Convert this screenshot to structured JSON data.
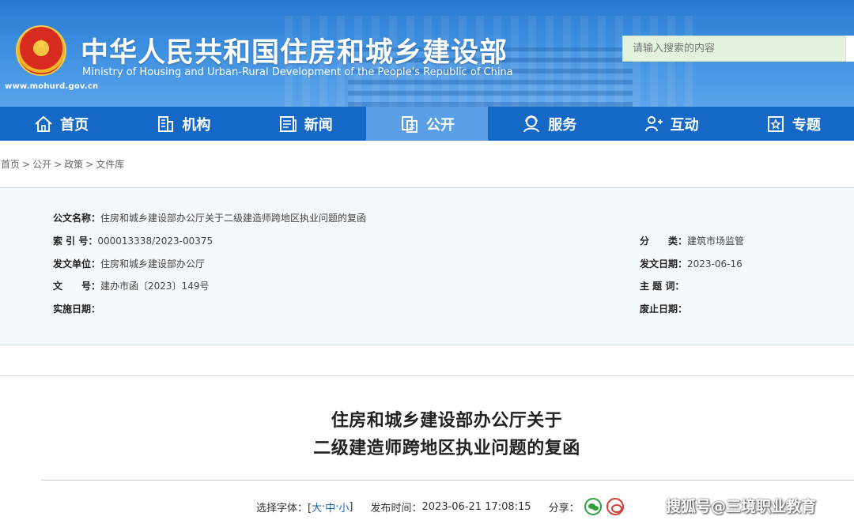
{
  "header": {
    "site_url": "www.mohurd.gov.cn",
    "title_cn": "中华人民共和国住房和城乡建设部",
    "title_en": "Ministry of Housing and Urban-Rural Development of the People's Republic of China",
    "search_placeholder": "请输入搜索的内容"
  },
  "nav": {
    "items": [
      {
        "label": "首页",
        "icon": "home-icon"
      },
      {
        "label": "机构",
        "icon": "building-icon"
      },
      {
        "label": "新闻",
        "icon": "news-icon"
      },
      {
        "label": "公开",
        "icon": "public-icon",
        "active": true
      },
      {
        "label": "服务",
        "icon": "service-icon"
      },
      {
        "label": "互动",
        "icon": "interaction-icon"
      },
      {
        "label": "专题",
        "icon": "topic-icon"
      }
    ]
  },
  "breadcrumb": [
    "首页",
    "公开",
    "政策",
    "文件库"
  ],
  "meta": {
    "doc_name_key": "公文名称：",
    "doc_name": "住房和城乡建设部办公厅关于二级建造师跨地区执业问题的复函",
    "index_key": "索 引 号：",
    "index": "000013338/2023-00375",
    "category_key": "分　　类：",
    "category": "建筑市场监管",
    "issuer_key": "发文单位：",
    "issuer": "住房和城乡建设部办公厅",
    "issue_date_key": "发文日期：",
    "issue_date": "2023-06-16",
    "doc_no_key": "文　　号：",
    "doc_no": "建办市函〔2023〕149号",
    "keywords_key": "主 题 词：",
    "keywords": "",
    "effective_key": "实施日期：",
    "effective": "",
    "expire_key": "废止日期：",
    "expire": ""
  },
  "document": {
    "title_line1": "住房和城乡建设部办公厅关于",
    "title_line2": "二级建造师跨地区执业问题的复函"
  },
  "info": {
    "font_label": "选择字体：[",
    "font_large": "大",
    "font_medium": "中",
    "font_small": "小",
    "font_close": "]",
    "sep": "·",
    "publish_label": "发布时间：",
    "publish_time": "2023-06-21 17:08:15",
    "share_label": "分享：",
    "watermark": "搜狐号@三境职业教育"
  },
  "colors": {
    "nav_bg": "#1668c7",
    "nav_active": "#5a9fe6",
    "header_bg": "#3d8fe0",
    "link": "#1a66c2"
  }
}
